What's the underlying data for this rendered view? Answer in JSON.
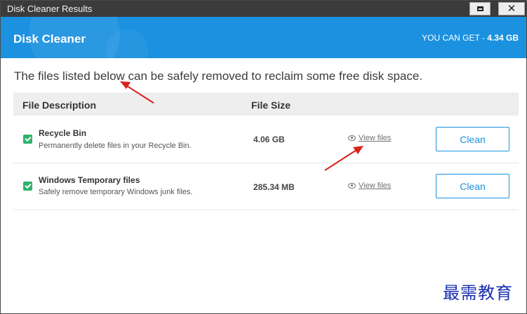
{
  "window": {
    "title": "Disk Cleaner Results"
  },
  "header": {
    "app_title": "Disk Cleaner",
    "you_can_get_label": "YOU CAN GET - ",
    "you_can_get_value": "4.34 GB",
    "accent_color": "#1b91e0"
  },
  "intro_text": "The files listed below can be safely removed to reclaim some free disk space.",
  "table": {
    "headers": {
      "description": "File Description",
      "size": "File Size"
    },
    "rows": [
      {
        "checked": true,
        "name": "Recycle Bin",
        "description": "Permanently delete files in your Recycle Bin.",
        "size": "4.06 GB",
        "view_label": "View files",
        "clean_label": "Clean"
      },
      {
        "checked": true,
        "name": "Windows Temporary files",
        "description": "Safely remove temporary Windows junk files.",
        "size": "285.34 MB",
        "view_label": "View files",
        "clean_label": "Clean"
      }
    ]
  },
  "watermark": "最需教育",
  "icons": [
    "restore-icon",
    "close-icon",
    "eye-icon",
    "checkbox-checked-icon",
    "annotation-arrow"
  ],
  "colors": {
    "annotation_red": "#d9231d",
    "checkbox_green": "#2fb36b",
    "watermark_blue": "#1a2fb0"
  }
}
